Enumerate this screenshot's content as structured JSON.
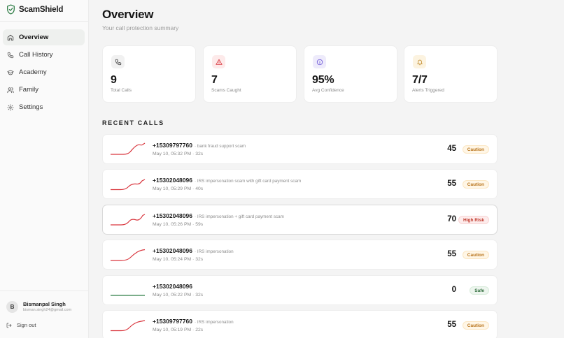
{
  "app": {
    "name": "ScamShield"
  },
  "nav": [
    {
      "label": "Overview",
      "icon": "home-icon",
      "active": true
    },
    {
      "label": "Call History",
      "icon": "phone-icon",
      "active": false
    },
    {
      "label": "Academy",
      "icon": "graduation-cap-icon",
      "active": false
    },
    {
      "label": "Family",
      "icon": "users-icon",
      "active": false
    },
    {
      "label": "Settings",
      "icon": "gear-icon",
      "active": false
    }
  ],
  "user": {
    "initial": "B",
    "name": "Bismanpal Singh",
    "email": "bisman.singh24@gmail.com"
  },
  "signout_label": "Sign out",
  "page": {
    "title": "Overview",
    "subtitle": "Your call protection summary"
  },
  "stats": [
    {
      "value": "9",
      "label": "Total Calls",
      "icon": "phone-icon",
      "accent": "#f1f1f1"
    },
    {
      "value": "7",
      "label": "Scams Caught",
      "icon": "warning-icon",
      "accent": "#fdeaea"
    },
    {
      "value": "95%",
      "label": "Avg Confidence",
      "icon": "info-icon",
      "accent": "#eeebfb"
    },
    {
      "value": "7/7",
      "label": "Alerts Triggered",
      "icon": "bell-icon",
      "accent": "#fcf3e0"
    }
  ],
  "recent_title": "RECENT CALLS",
  "calls": [
    {
      "number": "+15309797760",
      "desc": "· bank fraud support scam",
      "meta": "May 10, 05:32 PM · 32s",
      "score": "45",
      "status": "Caution",
      "status_type": "caution"
    },
    {
      "number": "+15302048096",
      "desc": "· IRS impersonation scam with gift card payment scam",
      "meta": "May 10, 05:29 PM · 40s",
      "score": "55",
      "status": "Caution",
      "status_type": "caution"
    },
    {
      "number": "+15302048096",
      "desc": "· IRS impersonation + gift card payment scam",
      "meta": "May 10, 05:26 PM · 59s",
      "score": "70",
      "status": "High Risk",
      "status_type": "high"
    },
    {
      "number": "+15302048096",
      "desc": "· IRS impersonation",
      "meta": "May 10, 05:24 PM · 32s",
      "score": "55",
      "status": "Caution",
      "status_type": "caution"
    },
    {
      "number": "+15302048096",
      "desc": "",
      "meta": "May 10, 05:22 PM · 32s",
      "score": "0",
      "status": "Safe",
      "status_type": "safe"
    },
    {
      "number": "+15309797760",
      "desc": "· IRS impersonation",
      "meta": "May 10, 05:19 PM · 22s",
      "score": "55",
      "status": "Caution",
      "status_type": "caution"
    }
  ],
  "colors": {
    "risk_line": "#d9363e",
    "safe_line": "#2f7d46",
    "brand": "#2f7d46"
  }
}
